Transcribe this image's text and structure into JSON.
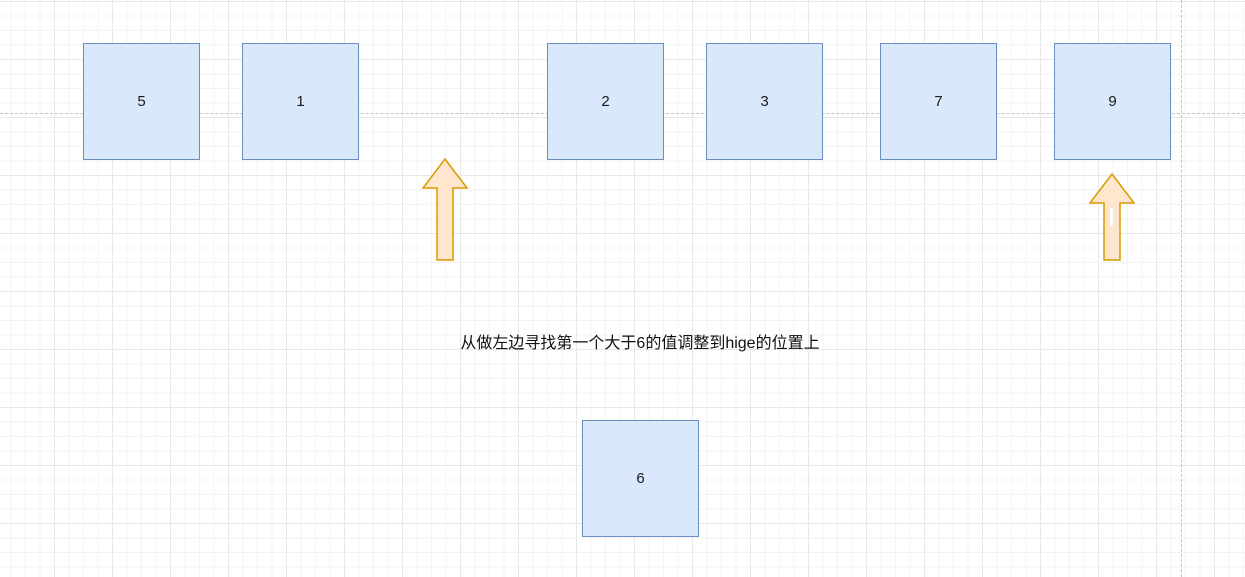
{
  "diagram": {
    "row_values": [
      "5",
      "1",
      "2",
      "3",
      "7",
      "9"
    ],
    "pivot_value": "6",
    "caption": "从做左边寻找第一个大于6的值调整到hige的位置上",
    "arrows": [
      {
        "name": "left-pointer-arrow",
        "direction": "up"
      },
      {
        "name": "right-pointer-arrow",
        "direction": "up"
      }
    ],
    "colors": {
      "box_fill": "#dae8fc",
      "box_stroke": "#6c8ebf",
      "arrow_fill": "#ffe6cc",
      "arrow_stroke": "#d79b00"
    }
  }
}
